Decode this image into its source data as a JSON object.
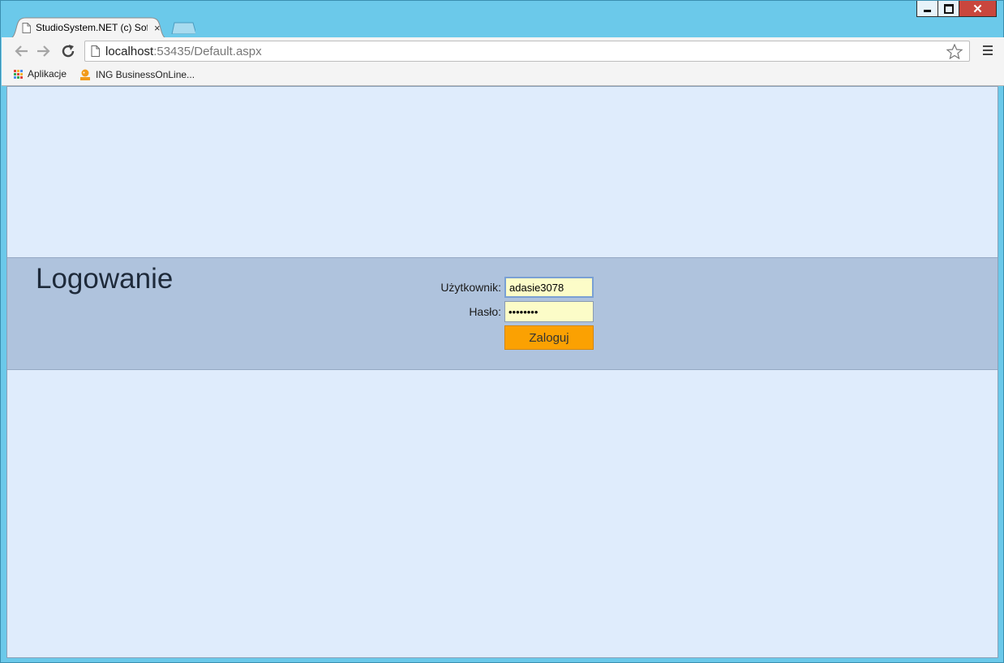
{
  "window": {
    "close_glyph": "✕"
  },
  "tabs": [
    {
      "title": "StudioSystem.NET (c) Sof",
      "close": "×"
    }
  ],
  "toolbar": {
    "url_host": "localhost",
    "url_rest": ":53435/Default.aspx"
  },
  "bookmarks": [
    {
      "label": "Aplikacje",
      "icon": "apps-grid-icon"
    },
    {
      "label": "ING BusinessOnLine...",
      "icon": "ing-lion-icon"
    }
  ],
  "login": {
    "title": "Logowanie",
    "username_label": "Użytkownik:",
    "username_value": "adasie3078",
    "password_label": "Hasło:",
    "password_value": "••••••••",
    "submit_label": "Zaloguj"
  },
  "colors": {
    "page_bg": "#dfecfc",
    "band_bg": "#afc3dd",
    "button_bg": "#fba102",
    "input_bg": "#fcfcc8",
    "chrome_frame": "#6bc9ea"
  }
}
